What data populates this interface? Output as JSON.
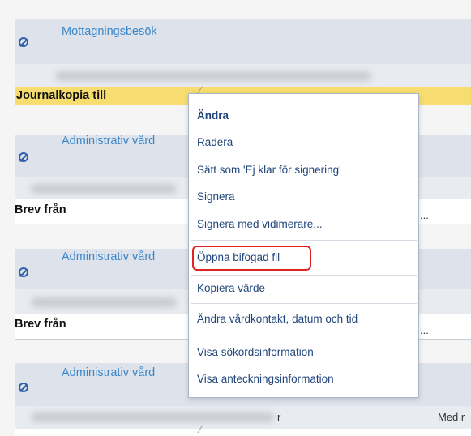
{
  "sections": [
    {
      "title": "Mottagningsbesök"
    },
    {
      "title": "Administrativ vård",
      "row_label": "Brev från"
    },
    {
      "title": "Administrativ vård",
      "row_label": "Brev från"
    },
    {
      "title": "Administrativ vård"
    }
  ],
  "highlight_row": {
    "label": "Journalkopia till"
  },
  "bottom_row": {
    "fragment": "r",
    "right_text": "Med r"
  },
  "context_menu": {
    "items": [
      {
        "label": "Ändra"
      },
      {
        "label": "Radera"
      },
      {
        "label": "Sätt som 'Ej klar för signering'"
      },
      {
        "label": "Signera"
      },
      {
        "label": "Signera med vidimerare..."
      },
      {
        "label": "Öppna bifogad fil"
      },
      {
        "label": "Kopiera värde"
      },
      {
        "label": "Ändra vårdkontakt, datum och tid"
      },
      {
        "label": "Visa sökordsinformation"
      },
      {
        "label": "Visa anteckningsinformation"
      }
    ]
  },
  "colors": {
    "accent": "#3a87c8",
    "highlight_row": "#f7dd70",
    "focus_ring": "#e02424"
  }
}
